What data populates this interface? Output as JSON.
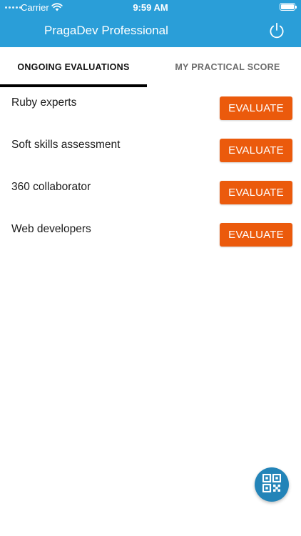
{
  "status_bar": {
    "carrier": "Carrier",
    "time": "9:59 AM"
  },
  "nav": {
    "title": "PragaDev Professional",
    "power_icon": "power-icon"
  },
  "tabs": [
    {
      "label": "ONGOING EVALUATIONS",
      "active": true
    },
    {
      "label": "MY PRACTICAL SCORE",
      "active": false
    }
  ],
  "evaluations": [
    {
      "name": "Ruby experts",
      "button_label": "EVALUATE"
    },
    {
      "name": "Soft skills assessment",
      "button_label": "EVALUATE"
    },
    {
      "name": "360 collaborator",
      "button_label": "EVALUATE"
    },
    {
      "name": "Web developers",
      "button_label": "EVALUATE"
    }
  ],
  "fab": {
    "icon": "qr-code-icon"
  },
  "colors": {
    "header": "#2a9ed8",
    "evaluate_button": "#eb5a0c",
    "fab": "#2384b8",
    "tab_indicator": "#000000"
  }
}
